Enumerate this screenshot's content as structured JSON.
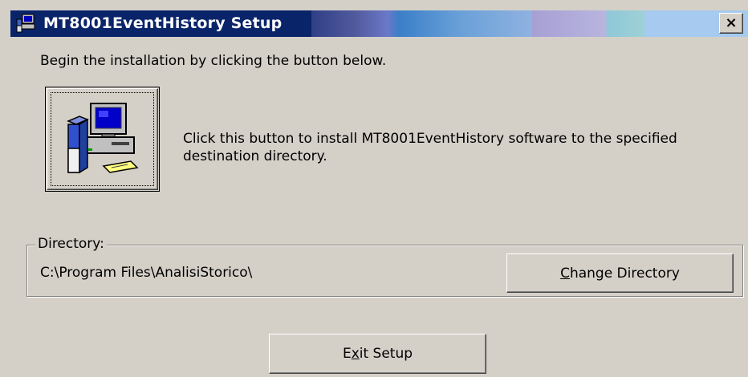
{
  "window": {
    "title": "MT8001EventHistory Setup",
    "icon": "setup-computer-icon",
    "close_glyph": "×"
  },
  "main": {
    "instruction": "Begin the installation by clicking the button below.",
    "install_button_icon": "computer-install-icon",
    "install_desc_line1": "Click this button to install MT8001EventHistory software to the specified",
    "install_desc_line2": "destination directory."
  },
  "directory": {
    "group_label": "Directory:",
    "path": "C:\\Program Files\\AnalisiStorico\\",
    "change_button": {
      "accel": "C",
      "rest": "hange Directory"
    }
  },
  "footer": {
    "exit_button": {
      "before": "E",
      "accel": "x",
      "after": "it Setup"
    }
  },
  "colors": {
    "title_bar_dark": "#0a246a",
    "face": "#d4d0c8"
  }
}
